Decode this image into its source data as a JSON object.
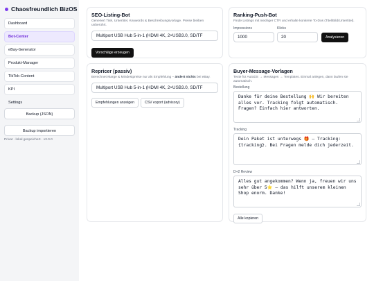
{
  "sidebar": {
    "title": "Chaosfreundlich BizOS",
    "items": [
      {
        "label": "Dashboard"
      },
      {
        "label": "Bot-Center"
      },
      {
        "label": "eBay-Generator"
      },
      {
        "label": "Produkt-Manager"
      },
      {
        "label": "TikTok-Content"
      },
      {
        "label": "KPI"
      },
      {
        "label": "Settings"
      }
    ],
    "backup_json": "Backup (JSON)",
    "backup_import": "Backup importieren",
    "status": "Privat · lokal gespeichert · v3.0.0"
  },
  "seo": {
    "title": "SEO-Listing-Bot",
    "desc": "Generiert Titel, Untertitel, Keywords & Beschreibungsvorlage. Preise bleiben unberührt.",
    "select_value": "Multiport USB Hub 5-in-1 (HDMI 4K, 2×USB3.0, SD/TF",
    "button": "Vorschläge erzeugen"
  },
  "ranking": {
    "title": "Ranking-Push-Bot",
    "desc": "Finde Listings mit niedriger CTR und erhalte konkrete To-Dos (Titel/Bild/Untertitel).",
    "impressions_label": "Impressions",
    "impressions_value": "1000",
    "clicks_label": "Klicks",
    "clicks_value": "20",
    "button": "Analysieren"
  },
  "repricer": {
    "title": "Repricer (passiv)",
    "desc_before": "Berechnet Marge & Mindestpreise nur als Empfehlung – ",
    "desc_bold": "ändert nichts",
    "desc_after": " bei eBay.",
    "select_value": "Multiport USB Hub 5-in-1 (HDMI 4K, 2×USB3.0, SD/TF",
    "btn_show": "Empfehlungen anzeigen",
    "btn_export": "CSV export (advisory)"
  },
  "buyer": {
    "title": "Buyer-Message-Vorlagen",
    "desc": "Texte für AutoDS → Messages → Templates. Einmal anlegen, dann laufen sie automatisch.",
    "templates": [
      {
        "label": "Bestellung",
        "text": "Danke für deine Bestellung 🙌 Wir bereiten alles vor. Tracking folgt automatisch. Fragen? Einfach hier antworten."
      },
      {
        "label": "Tracking",
        "text": "Dein Paket ist unterwegs 🎁 – Tracking: {tracking}. Bei Fragen melde dich jederzeit."
      },
      {
        "label": "D+2 Review",
        "text": "Alles gut angekommen? Wenn ja, freuen wir uns sehr über 5⭐ – das hilft unserem kleinen Shop enorm. Danke!"
      }
    ],
    "copy_button": "Alle kopieren"
  }
}
